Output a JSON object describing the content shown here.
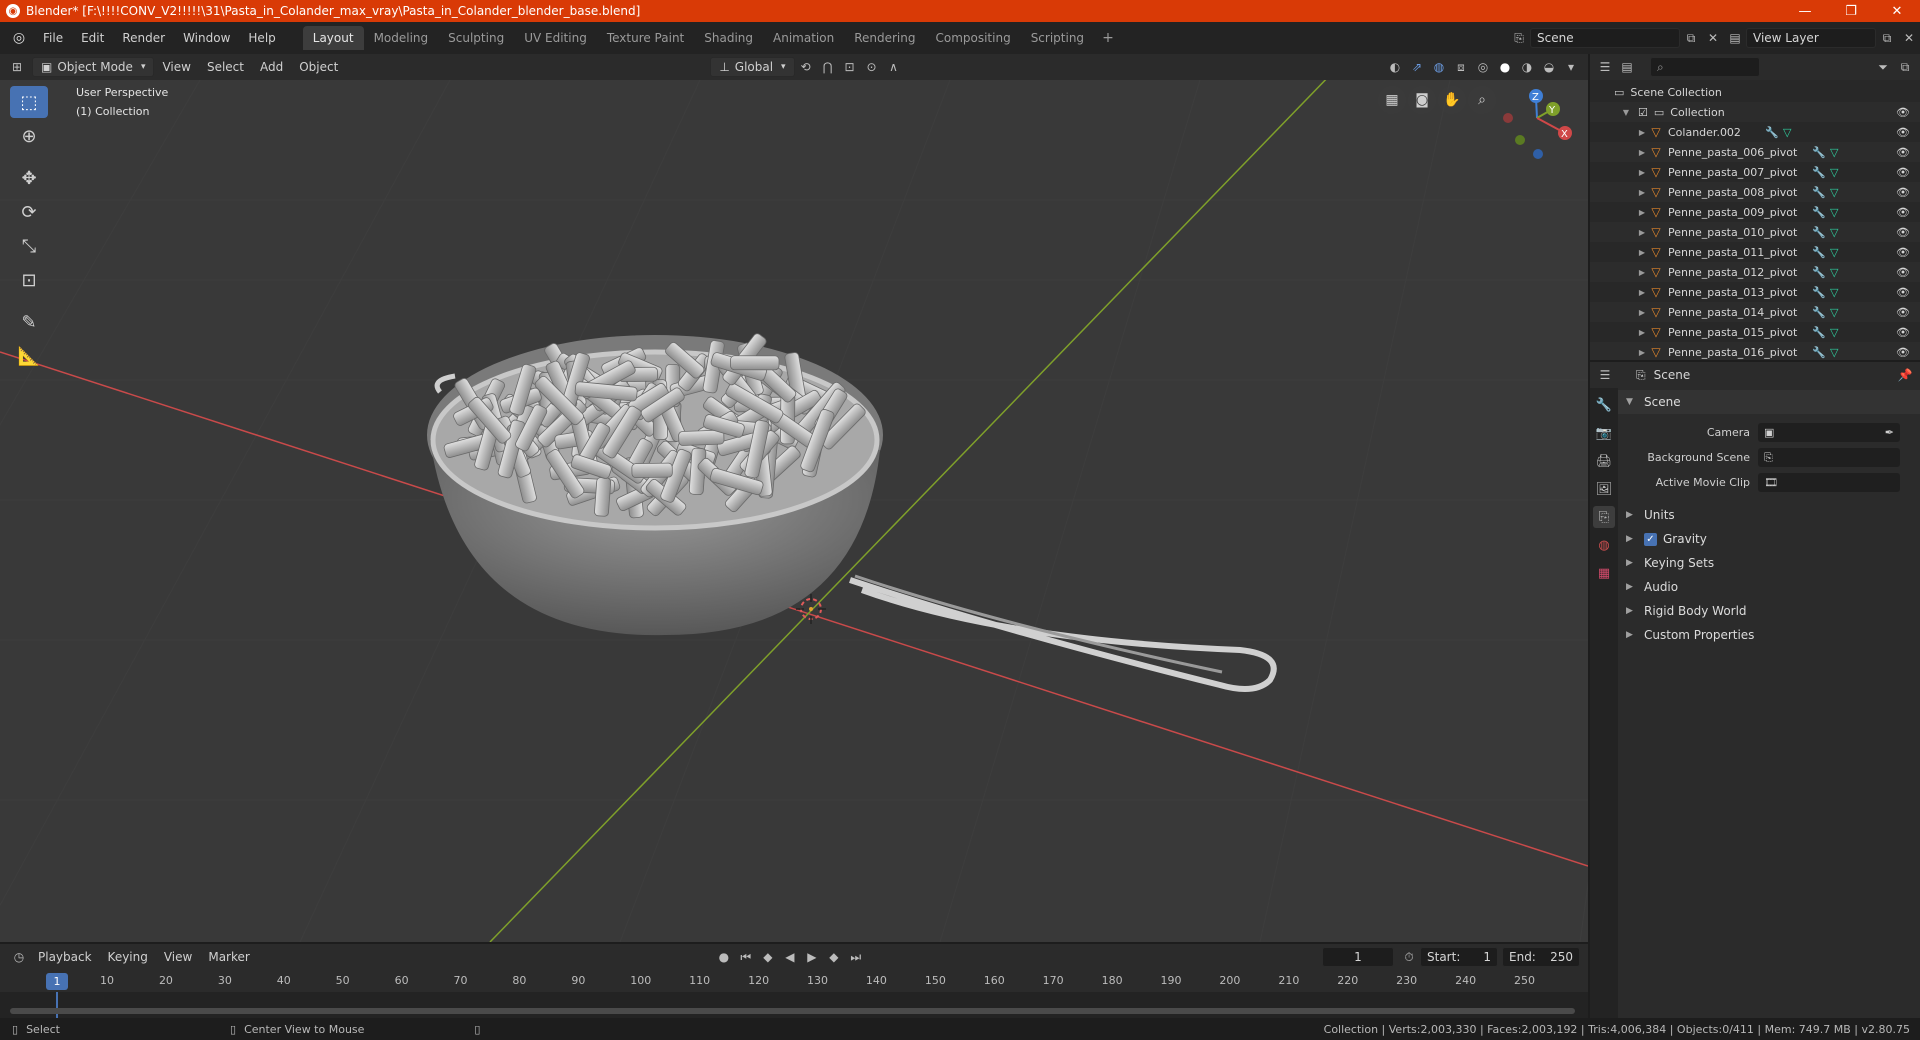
{
  "window": {
    "title": "Blender* [F:\\!!!!CONV_V2!!!!!\\31\\Pasta_in_Colander_max_vray\\Pasta_in_Colander_blender_base.blend]",
    "minimize": "—",
    "maximize": "❐",
    "close": "✕"
  },
  "menu": [
    "File",
    "Edit",
    "Render",
    "Window",
    "Help"
  ],
  "workspaces": [
    "Layout",
    "Modeling",
    "Sculpting",
    "UV Editing",
    "Texture Paint",
    "Shading",
    "Animation",
    "Rendering",
    "Compositing",
    "Scripting"
  ],
  "active_workspace": "Layout",
  "scene_field": "Scene",
  "view_layer_field": "View Layer",
  "viewport_header": {
    "mode": "Object Mode",
    "menus": [
      "View",
      "Select",
      "Add",
      "Object"
    ],
    "orientation": "Global"
  },
  "viewport": {
    "perspective": "User Perspective",
    "collection": "(1) Collection"
  },
  "gizmo": {
    "z": "Z",
    "y": "Y",
    "x": "X"
  },
  "outliner": {
    "root": "Scene Collection",
    "collection": "Collection",
    "objects": [
      "Colander.002",
      "Penne_pasta_006_pivot",
      "Penne_pasta_007_pivot",
      "Penne_pasta_008_pivot",
      "Penne_pasta_009_pivot",
      "Penne_pasta_010_pivot",
      "Penne_pasta_011_pivot",
      "Penne_pasta_012_pivot",
      "Penne_pasta_013_pivot",
      "Penne_pasta_014_pivot",
      "Penne_pasta_015_pivot",
      "Penne_pasta_016_pivot"
    ]
  },
  "properties": {
    "context": "Scene",
    "section": "Scene",
    "camera_label": "Camera",
    "background_scene_label": "Background Scene",
    "active_movie_clip_label": "Active Movie Clip",
    "panels": [
      "Units",
      "Gravity",
      "Keying Sets",
      "Audio",
      "Rigid Body World",
      "Custom Properties"
    ]
  },
  "timeline": {
    "menus": [
      "Playback",
      "Keying",
      "View",
      "Marker"
    ],
    "current_frame": "1",
    "start_label": "Start:",
    "start": "1",
    "end_label": "End:",
    "end": "250",
    "ticks": [
      "1",
      "10",
      "20",
      "30",
      "40",
      "50",
      "60",
      "70",
      "80",
      "90",
      "100",
      "110",
      "120",
      "130",
      "140",
      "150",
      "160",
      "170",
      "180",
      "190",
      "200",
      "210",
      "220",
      "230",
      "240",
      "250"
    ]
  },
  "status": {
    "select": "Select",
    "center_view": "Center View to Mouse",
    "stats": "Collection | Verts:2,003,330 | Faces:2,003,192 | Tris:4,006,384 | Objects:0/411 | Mem: 749.7 MB | v2.80.75"
  },
  "colors": {
    "titlebar": "#d93a06",
    "accent": "#4772b3",
    "viewport_bg": "#393939",
    "x_axis": "#c94a4a",
    "y_axis": "#7fa02a"
  }
}
